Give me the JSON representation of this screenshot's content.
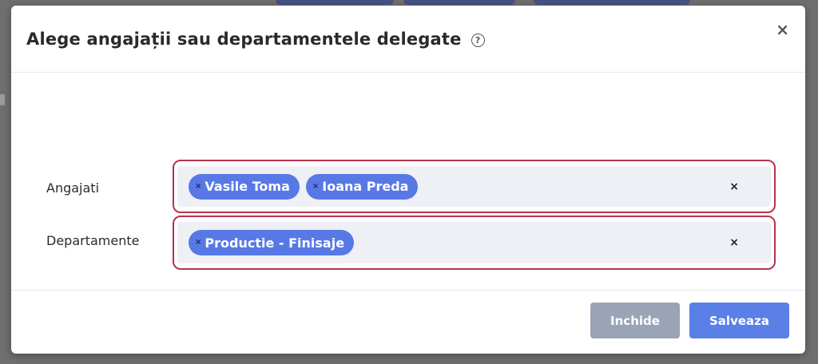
{
  "modal": {
    "title": "Alege angajații sau departamentele delegate",
    "help_icon": "?",
    "close_icon": "×"
  },
  "fields": {
    "employees": {
      "label": "Angajati",
      "chips": [
        "Vasile Toma",
        "Ioana Preda"
      ],
      "chip_remove_icon": "×",
      "clear_icon": "×"
    },
    "departments": {
      "label": "Departamente",
      "chips": [
        "Productie - Finisaje"
      ],
      "chip_remove_icon": "×",
      "clear_icon": "×"
    }
  },
  "footer": {
    "close_label": "Inchide",
    "save_label": "Salveaza"
  },
  "colors": {
    "chip": "#5878e6",
    "highlight_outline": "#b5344d",
    "close_button": "#9aa4b6",
    "save_button": "#5a7fe6"
  }
}
